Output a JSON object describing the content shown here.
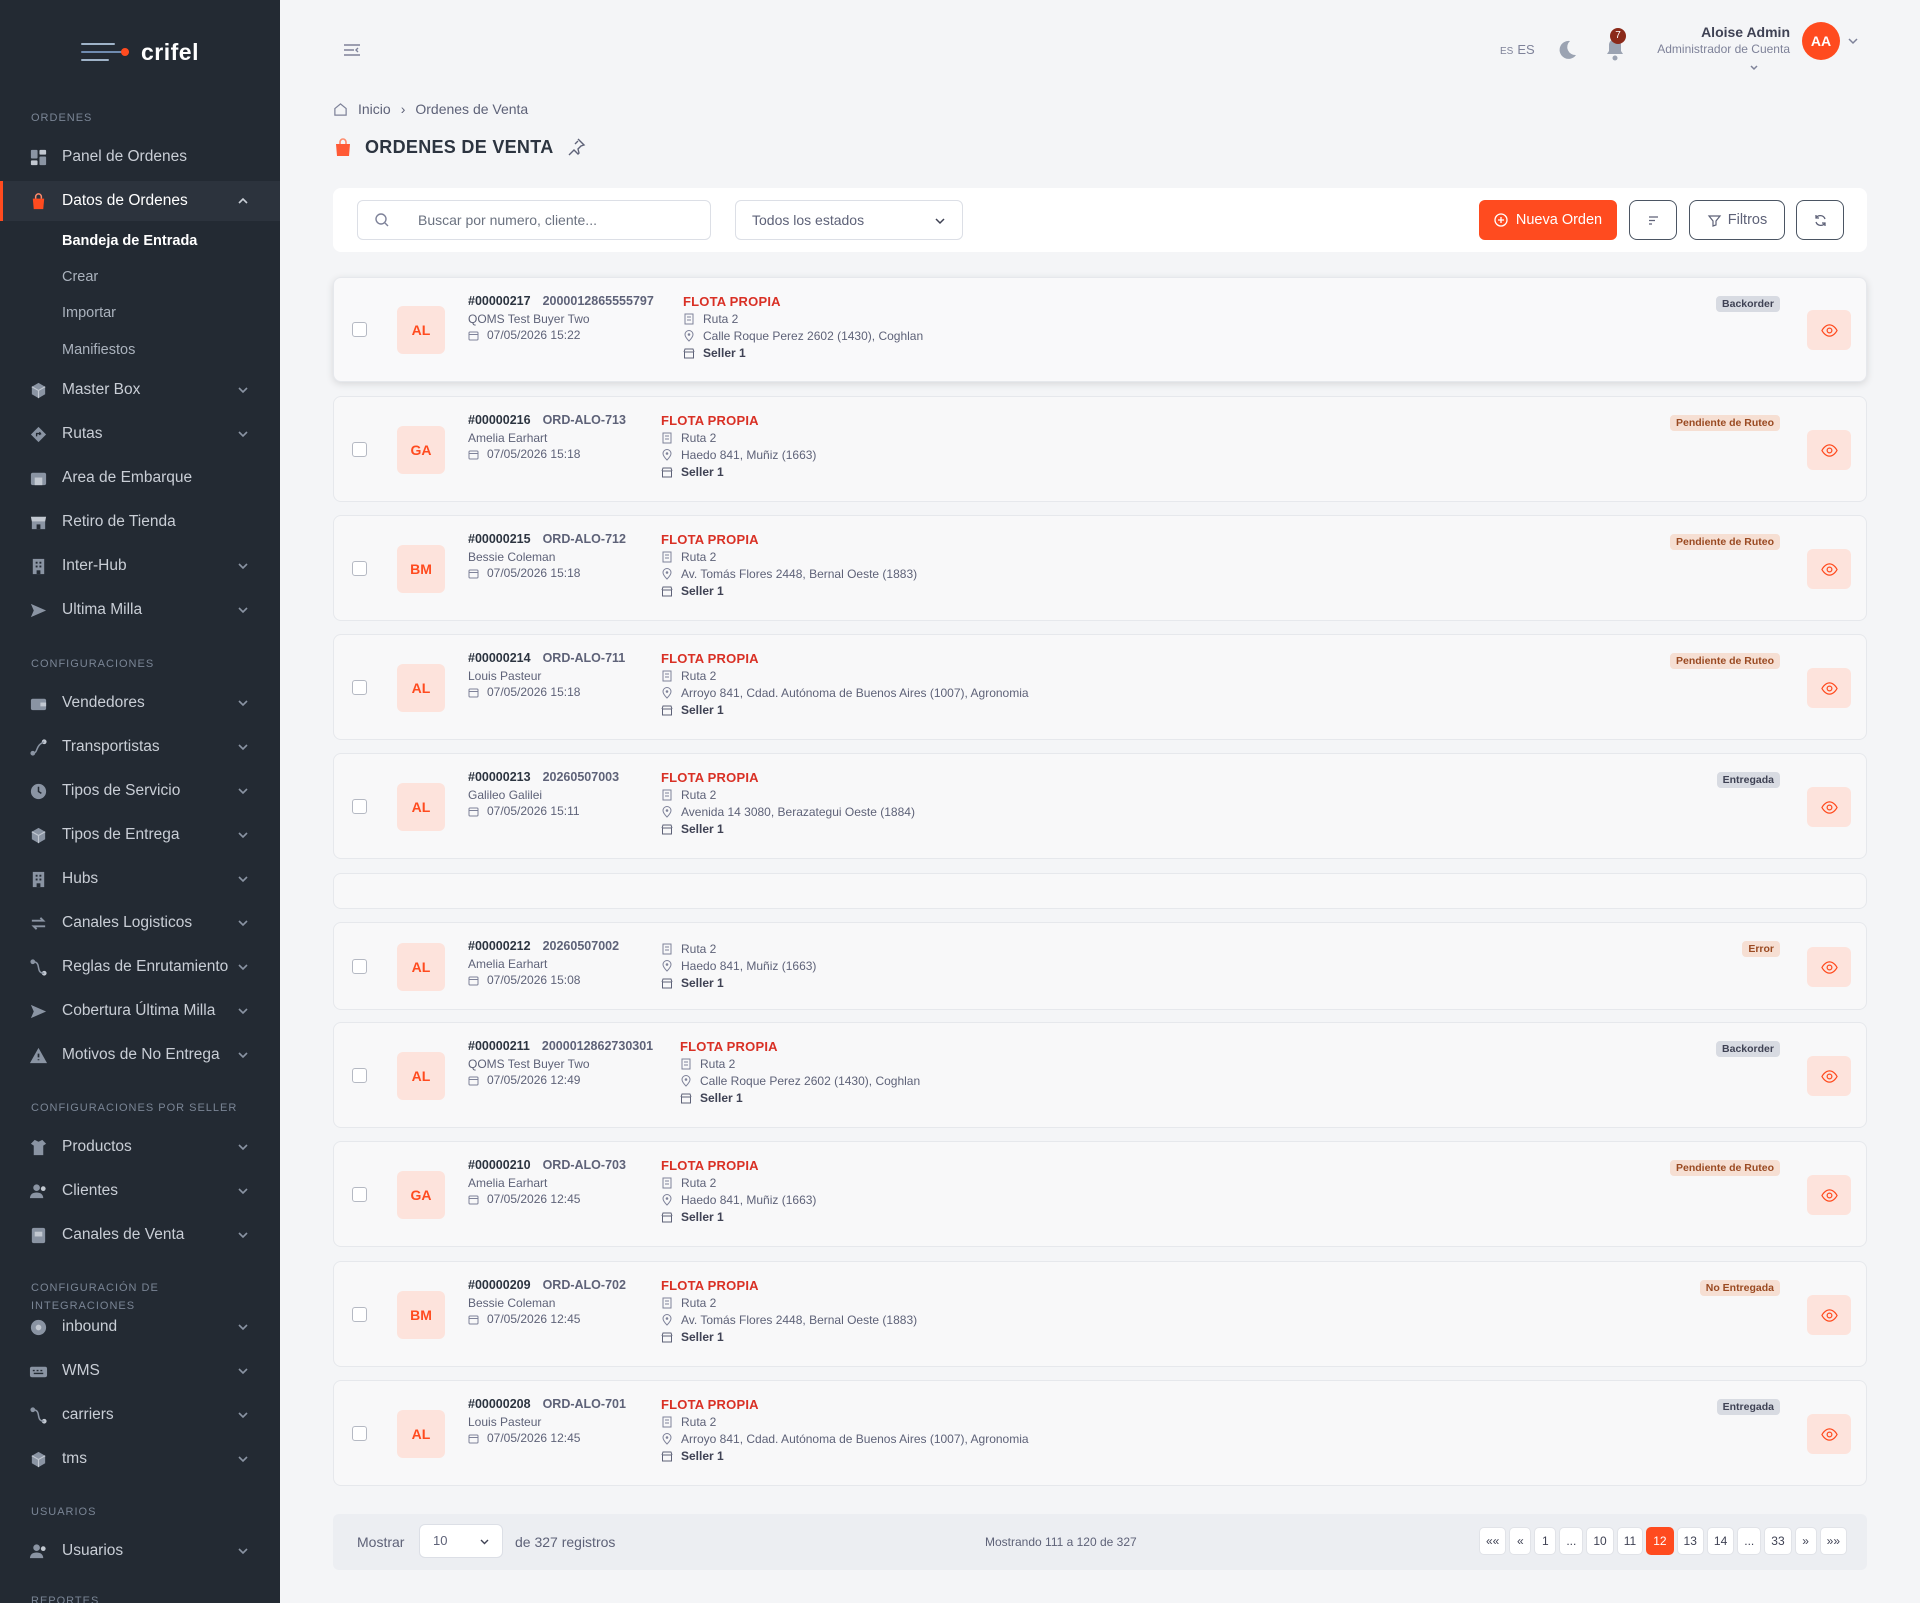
{
  "app": {
    "name": "crifel"
  },
  "colors": {
    "accent": "#ff4b1f",
    "sidebar_bg": "#232a33",
    "fleet_text": "#d93025"
  },
  "sidebar": {
    "section_ordenes": "ORDENES",
    "panel": "Panel de Ordenes",
    "datos": "Datos de Ordenes",
    "sub": [
      "Bandeja de Entrada",
      "Crear",
      "Importar",
      "Manifiestos"
    ],
    "master_box": "Master Box",
    "rutas": "Rutas",
    "area_embarque": "Area de Embarque",
    "retiro_tienda": "Retiro de Tienda",
    "inter_hub": "Inter-Hub",
    "ultima_milla": "Ultima Milla",
    "section_config": "CONFIGURACIONES",
    "vendedores": "Vendedores",
    "transportistas": "Transportistas",
    "tipos_servicio": "Tipos de Servicio",
    "tipos_entrega": "Tipos de Entrega",
    "hubs": "Hubs",
    "canales_logisticos": "Canales Logisticos",
    "reglas": "Reglas de Enrutamiento",
    "cobertura": "Cobertura Última Milla",
    "motivos": "Motivos de No Entrega",
    "section_seller": "CONFIGURACIONES POR SELLER",
    "productos": "Productos",
    "clientes": "Clientes",
    "canales_venta": "Canales de Venta",
    "section_integraciones": "CONFIGURACIÓN DE INTEGRACIONES",
    "inbound": "inbound",
    "wms": "WMS",
    "carriers": "carriers",
    "tms": "tms",
    "section_usuarios": "USUARIOS",
    "usuarios": "Usuarios",
    "section_reportes": "REPORTES"
  },
  "header": {
    "lang_code": "ES",
    "notif_count": "7",
    "user_name": "Aloise Admin",
    "user_role": "Administrador de Cuenta",
    "user_initials": "AA"
  },
  "breadcrumb": {
    "home": "Inicio",
    "current": "Ordenes de Venta"
  },
  "page": {
    "title": "ORDENES DE VENTA"
  },
  "toolbar": {
    "search_placeholder": "Buscar por numero, cliente...",
    "status_value": "Todos los estados",
    "new_order": "Nueva Orden",
    "filters": "Filtros"
  },
  "orders": [
    {
      "initials": "AL",
      "id": "#00000217",
      "ref": "2000012865555797",
      "buyer": "QOMS Test Buyer Two",
      "date": "07/05/2026 15:22",
      "fleet": "FLOTA PROPIA",
      "route": "Ruta 2",
      "address": "Calle Roque Perez 2602 (1430), Coghlan",
      "seller": "Seller 1",
      "status": "Backorder"
    },
    {
      "initials": "GA",
      "id": "#00000216",
      "ref": "ORD-ALO-713",
      "buyer": "Amelia Earhart",
      "date": "07/05/2026 15:18",
      "fleet": "FLOTA PROPIA",
      "route": "Ruta 2",
      "address": "Haedo 841, Muñiz (1663)",
      "seller": "Seller 1",
      "status": "Pendiente de Ruteo"
    },
    {
      "initials": "BM",
      "id": "#00000215",
      "ref": "ORD-ALO-712",
      "buyer": "Bessie Coleman",
      "date": "07/05/2026 15:18",
      "fleet": "FLOTA PROPIA",
      "route": "Ruta 2",
      "address": "Av. Tomás Flores 2448, Bernal Oeste (1883)",
      "seller": "Seller 1",
      "status": "Pendiente de Ruteo"
    },
    {
      "initials": "AL",
      "id": "#00000214",
      "ref": "ORD-ALO-711",
      "buyer": "Louis Pasteur",
      "date": "07/05/2026 15:18",
      "fleet": "FLOTA PROPIA",
      "route": "Ruta 2",
      "address": "Arroyo 841, Cdad. Autónoma de Buenos Aires (1007), Agronomia",
      "seller": "Seller 1",
      "status": "Pendiente de Ruteo"
    },
    {
      "initials": "AL",
      "id": "#00000213",
      "ref": "20260507003",
      "buyer": "Galileo Galilei",
      "date": "07/05/2026 15:11",
      "fleet": "FLOTA PROPIA",
      "route": "Ruta 2",
      "address": "Avenida 14 3080, Berazategui Oeste (1884)",
      "seller": "Seller 1",
      "status": "Entregada"
    },
    {
      "initials": "AL",
      "id": "#00000212",
      "ref": "20260507002",
      "buyer": "Amelia Earhart",
      "date": "07/05/2026 15:08",
      "fleet": "",
      "route": "Ruta 2",
      "address": "Haedo 841, Muñiz (1663)",
      "seller": "Seller 1",
      "status": "Error"
    },
    {
      "initials": "AL",
      "id": "#00000211",
      "ref": "2000012862730301",
      "buyer": "QOMS Test Buyer Two",
      "date": "07/05/2026 12:49",
      "fleet": "FLOTA PROPIA",
      "route": "Ruta 2",
      "address": "Calle Roque Perez 2602 (1430), Coghlan",
      "seller": "Seller 1",
      "status": "Backorder"
    },
    {
      "initials": "GA",
      "id": "#00000210",
      "ref": "ORD-ALO-703",
      "buyer": "Amelia Earhart",
      "date": "07/05/2026 12:45",
      "fleet": "FLOTA PROPIA",
      "route": "Ruta 2",
      "address": "Haedo 841, Muñiz (1663)",
      "seller": "Seller 1",
      "status": "Pendiente de Ruteo"
    },
    {
      "initials": "BM",
      "id": "#00000209",
      "ref": "ORD-ALO-702",
      "buyer": "Bessie Coleman",
      "date": "07/05/2026 12:45",
      "fleet": "FLOTA PROPIA",
      "route": "Ruta 2",
      "address": "Av. Tomás Flores 2448, Bernal Oeste (1883)",
      "seller": "Seller 1",
      "status": "No Entregada"
    },
    {
      "initials": "AL",
      "id": "#00000208",
      "ref": "ORD-ALO-701",
      "buyer": "Louis Pasteur",
      "date": "07/05/2026 12:45",
      "fleet": "FLOTA PROPIA",
      "route": "Ruta 2",
      "address": "Arroyo 841, Cdad. Autónoma de Buenos Aires (1007), Agronomia",
      "seller": "Seller 1",
      "status": "Entregada"
    }
  ],
  "pagination": {
    "show_label": "Mostrar",
    "page_size": "10",
    "records": "de 327 registros",
    "showing": "Mostrando 111 a 120 de 327",
    "first": "««",
    "prev": "«",
    "p1": "1",
    "ellipsis1": "...",
    "p10": "10",
    "p11": "11",
    "p12": "12",
    "p13": "13",
    "p14": "14",
    "ellipsis2": "...",
    "p33": "33",
    "next": "»",
    "last": "»»"
  }
}
